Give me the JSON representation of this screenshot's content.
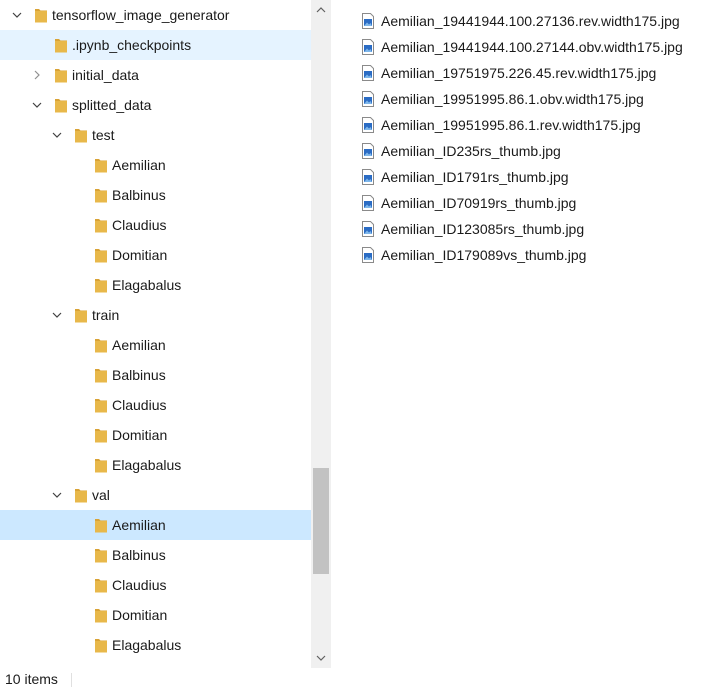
{
  "colors": {
    "folder": "#e8b84a",
    "folder_dark": "#d9a336",
    "selected": "#cce8ff",
    "hover": "#e5f3ff"
  },
  "icons": {
    "folder": "folder-icon",
    "expanded": "chevron-down-icon",
    "collapsed": "chevron-right-icon",
    "file": "image-file-icon"
  },
  "nav_tree": [
    {
      "label": "tensorflow_image_generator",
      "level": 0,
      "toggle": "expanded",
      "state": ""
    },
    {
      "label": ".ipynb_checkpoints",
      "level": 1,
      "toggle": "none",
      "state": "hover"
    },
    {
      "label": "initial_data",
      "level": 1,
      "toggle": "collapsed",
      "state": ""
    },
    {
      "label": "splitted_data",
      "level": 1,
      "toggle": "expanded",
      "state": ""
    },
    {
      "label": "test",
      "level": 2,
      "toggle": "expanded",
      "state": ""
    },
    {
      "label": "Aemilian",
      "level": 3,
      "toggle": "none",
      "state": ""
    },
    {
      "label": "Balbinus",
      "level": 3,
      "toggle": "none",
      "state": ""
    },
    {
      "label": "Claudius",
      "level": 3,
      "toggle": "none",
      "state": ""
    },
    {
      "label": "Domitian",
      "level": 3,
      "toggle": "none",
      "state": ""
    },
    {
      "label": "Elagabalus",
      "level": 3,
      "toggle": "none",
      "state": ""
    },
    {
      "label": "train",
      "level": 2,
      "toggle": "expanded",
      "state": ""
    },
    {
      "label": "Aemilian",
      "level": 3,
      "toggle": "none",
      "state": ""
    },
    {
      "label": "Balbinus",
      "level": 3,
      "toggle": "none",
      "state": ""
    },
    {
      "label": "Claudius",
      "level": 3,
      "toggle": "none",
      "state": ""
    },
    {
      "label": "Domitian",
      "level": 3,
      "toggle": "none",
      "state": ""
    },
    {
      "label": "Elagabalus",
      "level": 3,
      "toggle": "none",
      "state": ""
    },
    {
      "label": "val",
      "level": 2,
      "toggle": "expanded",
      "state": ""
    },
    {
      "label": "Aemilian",
      "level": 3,
      "toggle": "none",
      "state": "selected"
    },
    {
      "label": "Balbinus",
      "level": 3,
      "toggle": "none",
      "state": ""
    },
    {
      "label": "Claudius",
      "level": 3,
      "toggle": "none",
      "state": ""
    },
    {
      "label": "Domitian",
      "level": 3,
      "toggle": "none",
      "state": ""
    },
    {
      "label": "Elagabalus",
      "level": 3,
      "toggle": "none",
      "state": ""
    }
  ],
  "files": [
    "Aemilian_19441944.100.27136.rev.width175.jpg",
    "Aemilian_19441944.100.27144.obv.width175.jpg",
    "Aemilian_19751975.226.45.rev.width175.jpg",
    "Aemilian_19951995.86.1.obv.width175.jpg",
    "Aemilian_19951995.86.1.rev.width175.jpg",
    "Aemilian_ID235rs_thumb.jpg",
    "Aemilian_ID1791rs_thumb.jpg",
    "Aemilian_ID70919rs_thumb.jpg",
    "Aemilian_ID123085rs_thumb.jpg",
    "Aemilian_ID179089vs_thumb.jpg"
  ],
  "status": {
    "item_count": "10 items"
  },
  "scrollbar": {
    "position_fraction": 0.78
  }
}
